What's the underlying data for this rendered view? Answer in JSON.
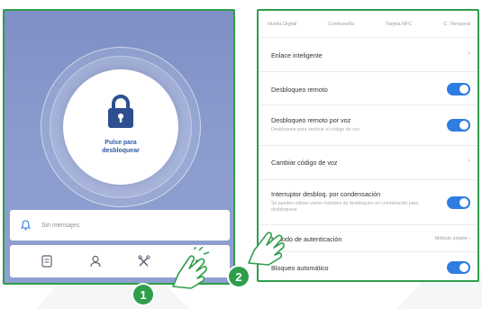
{
  "left_screen": {
    "unlock_label": "Pulse para desbloquear",
    "notice_text": "Sin mensajes",
    "toolbar_icons": [
      "records-icon",
      "user-icon",
      "tools-icon",
      "more-icon"
    ],
    "more_label": "•••"
  },
  "right_screen": {
    "tabs": [
      "Huella Digital",
      "Contraseña",
      "Tarjeta NFC",
      "C. Temporal"
    ],
    "rows": [
      {
        "title": "Enlace inteligente",
        "type": "chevron",
        "chevron": "›"
      },
      {
        "title": "Desbloqueo remoto",
        "type": "toggle",
        "on": true
      },
      {
        "title": "Desbloqueo remoto por voz",
        "subtitle": "Desbloquee para verificar el código de voz",
        "type": "toggle",
        "on": true
      },
      {
        "title": "Cambiar código de voz",
        "type": "chevron",
        "chevron": "›"
      },
      {
        "title": "Interruptor desbloq. por condensación",
        "subtitle": "Se pueden utilizar varios métodos de desbloqueo en combinación para desbloquear",
        "type": "toggle",
        "on": true
      },
      {
        "title": "Método de autenticación",
        "value": "Método simple ›",
        "type": "value"
      },
      {
        "title": "Bloqueo automático",
        "type": "toggle",
        "on": true
      }
    ]
  },
  "steps": {
    "one": "1",
    "two": "2"
  },
  "colors": {
    "accent_green": "#2f9e4b",
    "toggle_blue": "#2f7de1",
    "screen_bg": "#8a9bce"
  }
}
